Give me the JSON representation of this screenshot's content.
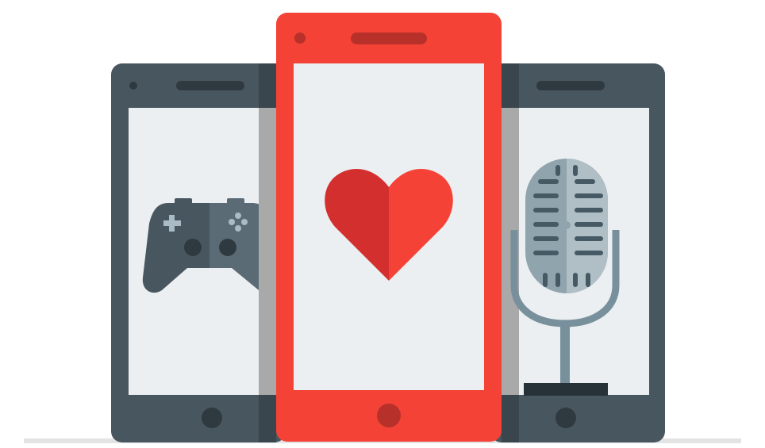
{
  "scene": {
    "colors": {
      "background": "#ffffff",
      "device_dark": "#48565f",
      "device_dark_shade": "#3a464e",
      "screen": "#eceff1",
      "divider_gray": "#a9a9a9",
      "device_red": "#f44236",
      "device_red_detail": "#c62f27",
      "heart_left": "#d32f2f",
      "heart_right": "#f44336",
      "gamepad_left": "#48565f",
      "gamepad_right": "#5b6b75",
      "gamepad_glyph": "#9fb2bc",
      "mic_head": "#90a4ae",
      "mic_head_light": "#b0bec5",
      "mic_grille": "#455a64",
      "mic_stand": "#78909c",
      "mic_base": "#263238",
      "floor_shadow": "#d9d9d9"
    },
    "devices": [
      {
        "id": "left-phone",
        "icon": "gamepad-icon",
        "color": "device_dark"
      },
      {
        "id": "center-phone",
        "icon": "heart-icon",
        "color": "device_red"
      },
      {
        "id": "right-phone",
        "icon": "microphone-icon",
        "color": "device_dark"
      }
    ]
  }
}
